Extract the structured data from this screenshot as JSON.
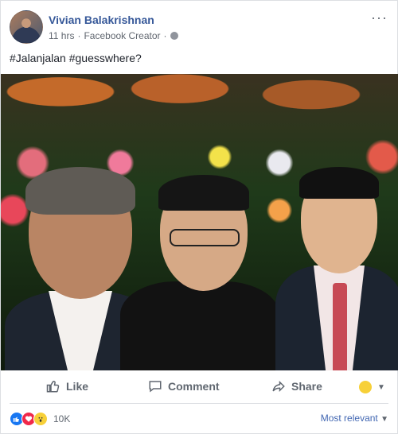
{
  "post": {
    "author": "Vivian Balakrishnan",
    "time": "11 hrs",
    "separator": "·",
    "source": "Facebook Creator",
    "privacy_icon": "globe-icon",
    "more_icon": "···",
    "text": "#Jalanjalan #guesswhere?"
  },
  "actions": {
    "like": "Like",
    "comment": "Comment",
    "share": "Share",
    "like_icon": "thumbs-up-icon",
    "comment_icon": "speech-bubble-icon",
    "share_icon": "share-arrow-icon",
    "react_caret": "▼"
  },
  "footer": {
    "reaction_count": "10K",
    "reactions": [
      "like",
      "love",
      "wow"
    ],
    "sort_label": "Most relevant",
    "sort_caret": "▼"
  },
  "colors": {
    "link": "#365899",
    "muted": "#606770",
    "like_blue": "#1877f2",
    "love_red": "#f0284a",
    "wow_yellow": "#f7d038"
  }
}
